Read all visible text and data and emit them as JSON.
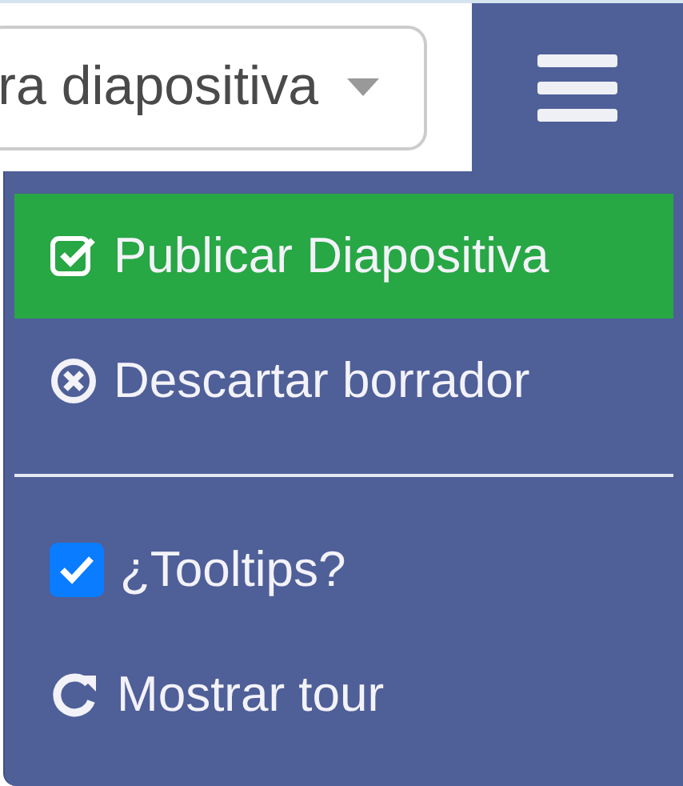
{
  "select": {
    "value": "ra diapositiva"
  },
  "menu_items": [
    {
      "kind": "publish",
      "label": "Publicar Diapositiva",
      "selected": true
    },
    {
      "kind": "discard",
      "label": "Descartar borrador",
      "selected": false
    },
    {
      "kind": "divider"
    },
    {
      "kind": "checkbox",
      "label": "¿Tooltips?",
      "checked": true
    },
    {
      "kind": "tour",
      "label": "Mostrar tour",
      "selected": false
    }
  ]
}
